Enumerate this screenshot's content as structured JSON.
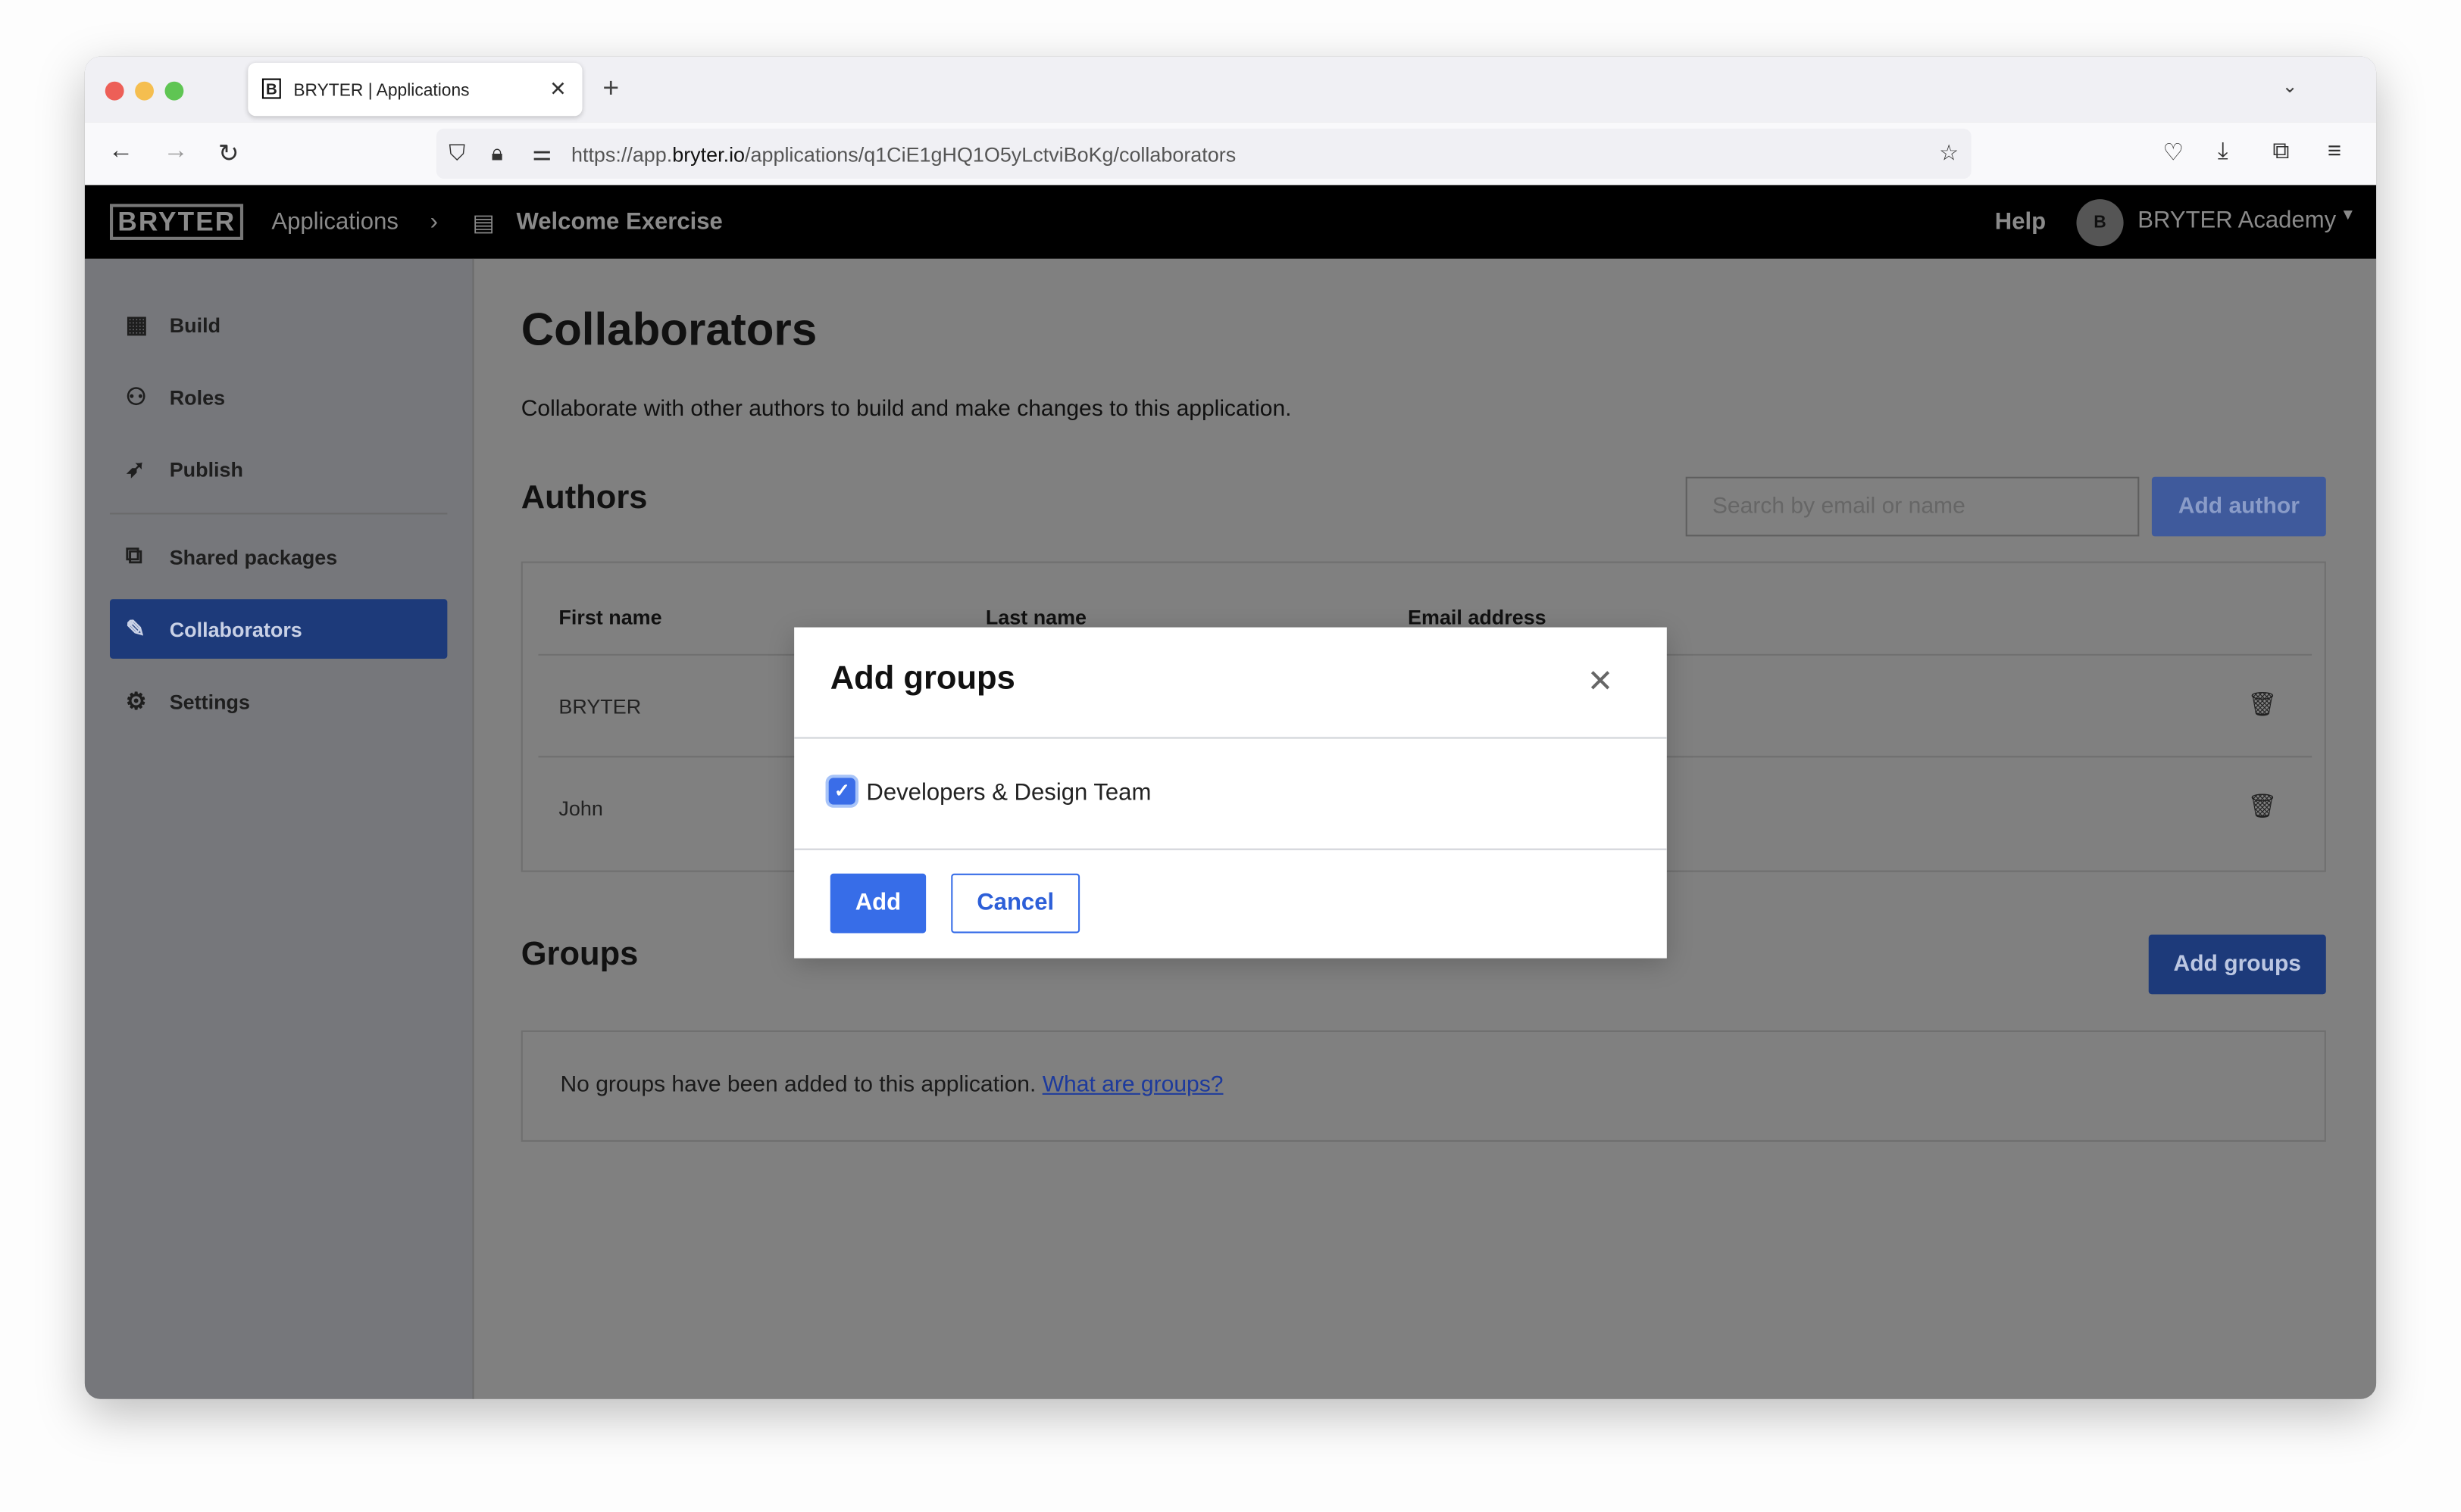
{
  "browser": {
    "tab_title": "BRYTER | Applications",
    "tab_favicon": "B",
    "url_prefix": "https://app.",
    "url_domain": "bryter.io",
    "url_path": "/applications/q1CiE1gHQ1O5yLctviBoKg/collaborators"
  },
  "header": {
    "logo": "BRYTER",
    "breadcrumb_root": "Applications",
    "breadcrumb_current": "Welcome Exercise",
    "help": "Help",
    "avatar_initial": "B",
    "account": "BRYTER Academy"
  },
  "sidebar": {
    "items": [
      {
        "label": "Build",
        "icon": "grid-icon"
      },
      {
        "label": "Roles",
        "icon": "users-icon"
      },
      {
        "label": "Publish",
        "icon": "rocket-icon"
      },
      {
        "label": "Shared packages",
        "icon": "package-icon"
      },
      {
        "label": "Collaborators",
        "icon": "collaborators-icon",
        "active": true
      },
      {
        "label": "Settings",
        "icon": "gear-icon"
      }
    ]
  },
  "main": {
    "title": "Collaborators",
    "description": "Collaborate with other authors to build and make changes to this application.",
    "authors_title": "Authors",
    "search_placeholder": "Search by email or name",
    "add_author": "Add author",
    "columns": [
      "First name",
      "Last name",
      "Email address"
    ],
    "rows": [
      {
        "first_name": "BRYTER"
      },
      {
        "first_name": "John"
      }
    ],
    "groups_title": "Groups",
    "add_groups": "Add groups",
    "groups_empty": "No groups have been added to this application.",
    "groups_link": "What are groups?"
  },
  "modal": {
    "title": "Add groups",
    "option_label": "Developers & Design Team",
    "option_checked": true,
    "add": "Add",
    "cancel": "Cancel"
  },
  "colors": {
    "primary": "#376de8",
    "header": "#000000",
    "overlay": "#808080"
  }
}
